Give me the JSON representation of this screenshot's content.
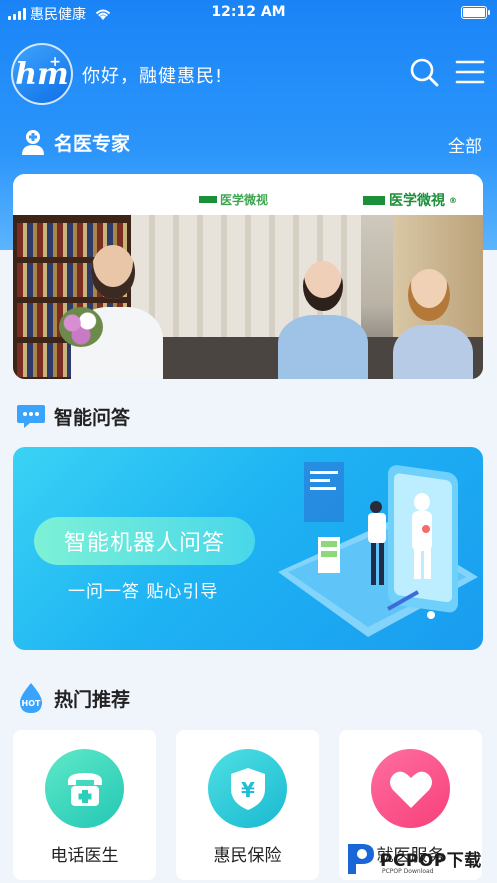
{
  "status_bar": {
    "carrier": "惠民健康",
    "time": "12:12 AM",
    "battery_level": 1.0
  },
  "header": {
    "logo_text": "hm",
    "greeting": "你好，融健惠民!",
    "search_icon": "search-icon",
    "menu_icon": "menu-icon"
  },
  "experts": {
    "title": "名医专家",
    "all_label": "全部",
    "video_brand": "医学微視",
    "video_caption": "医学微视"
  },
  "qa": {
    "title": "智能问答",
    "banner_pill": "智能机器人问答",
    "banner_sub": "一问一答  贴心引导"
  },
  "recommend": {
    "title": "热门推荐",
    "hot_badge": "HOT",
    "items": [
      {
        "label": "电话医生",
        "icon": "telephone-icon",
        "color": "#2bcfb9"
      },
      {
        "label": "惠民保险",
        "icon": "shield-yen-icon",
        "color": "#1fbfd6"
      },
      {
        "label": "就医服务",
        "icon": "heart-icon",
        "color": "#f84a82"
      }
    ]
  },
  "watermark": {
    "text": "PCPOP下载",
    "sub": "PCPOP Download"
  },
  "colors": {
    "primary": "#1a84f7",
    "background": "#f0f4fb"
  }
}
